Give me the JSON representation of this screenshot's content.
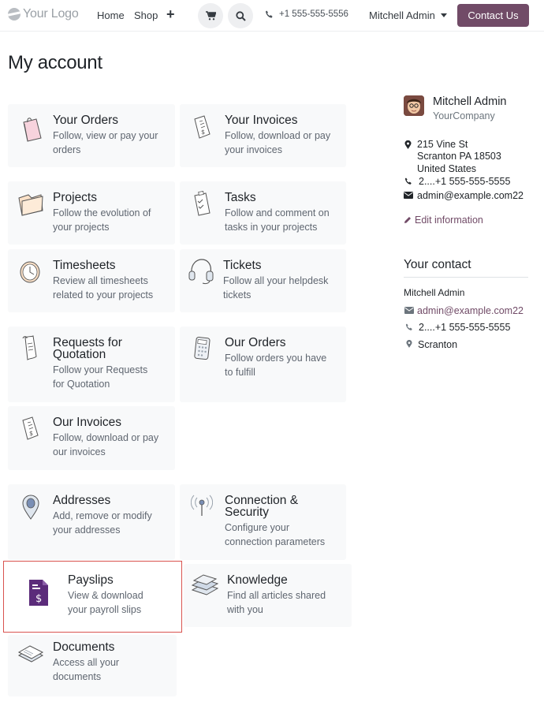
{
  "header": {
    "logo_text": "Your Logo",
    "nav": [
      "Home",
      "Shop"
    ],
    "phone": "+1 555-555-5556",
    "user": "Mitchell Admin",
    "contact_button": "Contact Us"
  },
  "page_title": "My account",
  "cards": [
    {
      "title": "Your Orders",
      "desc1": "Follow, view or pay your",
      "desc2": "orders",
      "icon": "shopping-bag-icon"
    },
    {
      "title": "Your Invoices",
      "desc1": "Follow, download or pay",
      "desc2": "your invoices",
      "icon": "invoice-icon"
    },
    {
      "title": "Projects",
      "desc1": "Follow the evolution of",
      "desc2": "your projects",
      "icon": "folder-icon"
    },
    {
      "title": "Tasks",
      "desc1": "Follow and comment on",
      "desc2": "tasks in your projects",
      "icon": "clipboard-icon"
    },
    {
      "title": "Timesheets",
      "desc1": "Review all timesheets",
      "desc2": "related to your projects",
      "icon": "clock-icon"
    },
    {
      "title": "Tickets",
      "desc1": "Follow all your helpdesk",
      "desc2": "tickets",
      "icon": "headset-icon"
    },
    {
      "title1": "Requests for",
      "title2": "Quotation",
      "desc1": "Follow your Requests",
      "desc2": "for Quotation",
      "icon": "scroll-icon"
    },
    {
      "title": "Our Orders",
      "desc1": "Follow orders you have",
      "desc2": "to fulfill",
      "icon": "calculator-icon"
    },
    {
      "title": "Our Invoices",
      "desc1": "Follow, download or pay",
      "desc2": "our invoices",
      "icon": "invoice-icon"
    },
    {
      "title": "Addresses",
      "desc1": "Add, remove or modify",
      "desc2": "your addresses",
      "icon": "map-pin-icon"
    },
    {
      "title1": "Connection &",
      "title2": "Security",
      "desc1": "Configure your",
      "desc2": "connection parameters",
      "icon": "antenna-icon"
    },
    {
      "title": "Payslips",
      "desc1": "View & download",
      "desc2": "your payroll slips",
      "icon": "payslip-icon"
    },
    {
      "title": "Knowledge",
      "desc1": "Find all articles shared",
      "desc2": "with you",
      "icon": "books-icon"
    },
    {
      "title": "Documents",
      "desc1": "Access all your",
      "desc2": "documents",
      "icon": "documents-icon"
    }
  ],
  "sidebar": {
    "name": "Mitchell Admin",
    "company": "YourCompany",
    "address1": "215 Vine St",
    "address2": "Scranton PA 18503",
    "address3": "United States",
    "phone": "2....+1 555-555-5555",
    "email": "admin@example.com22",
    "edit_link": "Edit information",
    "contact_heading": "Your contact",
    "contact_name": "Mitchell Admin",
    "contact_email": "admin@example.com22",
    "contact_phone": "2....+1 555-555-5555",
    "contact_city": "Scranton"
  },
  "colors": {
    "brand": "#714b67",
    "highlight": "#d9534f",
    "card_bg": "#f8f9fa"
  }
}
